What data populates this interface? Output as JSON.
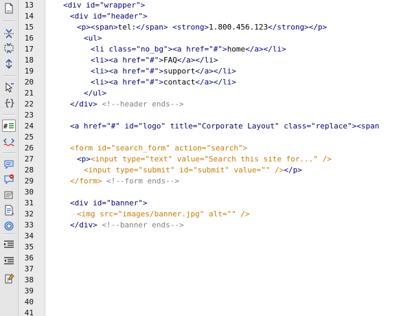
{
  "toolbar": {
    "tools": [
      "open-documents-icon",
      "collapse-full-tag-icon",
      "collapse-selection-icon",
      "expand-all-icon",
      "select-parent-tag-icon",
      "balance-braces-icon",
      "line-numbers-icon",
      "highlight-invalid-code-icon",
      "apply-comment-icon",
      "remove-comment-icon",
      "wrap-tag-icon",
      "recent-snippets-icon",
      "move-css-icon",
      "indent-code-icon",
      "outdent-code-icon",
      "format-source-code-icon"
    ]
  },
  "gutter": {
    "line_numbers": [
      "13",
      "14",
      "15",
      "16",
      "17",
      "18",
      "19",
      "20",
      "21",
      "22",
      "23",
      "24",
      "25",
      "26",
      "27",
      "28",
      "29",
      "30",
      "31",
      "32",
      "33",
      "34",
      "35",
      "36",
      "37",
      "38",
      "39",
      "40",
      "41"
    ]
  },
  "code": {
    "lines": [
      [
        {
          "t": "<div id=\"wrapper\">",
          "c": "tag"
        }
      ],
      [
        {
          "t": "<div id=\"header\">",
          "c": "tag"
        }
      ],
      [
        {
          "t": "<p><span>",
          "c": "tag"
        },
        {
          "t": "tel:",
          "c": "txt"
        },
        {
          "t": "</span> <strong>",
          "c": "tag"
        },
        {
          "t": "1.800.456.123",
          "c": "txt"
        },
        {
          "t": "</strong></p>",
          "c": "tag"
        }
      ],
      [
        {
          "t": "<ul>",
          "c": "tag"
        }
      ],
      [
        {
          "t": "<li class=\"no_bg\"><a href=\"#\">",
          "c": "tag"
        },
        {
          "t": "home",
          "c": "txt"
        },
        {
          "t": "</a></li>",
          "c": "tag"
        }
      ],
      [
        {
          "t": "<li><a href=\"#\">",
          "c": "tag"
        },
        {
          "t": "FAQ",
          "c": "txt"
        },
        {
          "t": "</a></li>",
          "c": "tag"
        }
      ],
      [
        {
          "t": "<li><a href=\"#\">",
          "c": "tag"
        },
        {
          "t": "support",
          "c": "txt"
        },
        {
          "t": "</a></li>",
          "c": "tag"
        }
      ],
      [
        {
          "t": "<li><a href=\"#\">",
          "c": "tag"
        },
        {
          "t": "contact",
          "c": "txt"
        },
        {
          "t": "</a></li>",
          "c": "tag"
        }
      ],
      [
        {
          "t": "</ul>",
          "c": "tag"
        }
      ],
      [
        {
          "t": "</div>",
          "c": "tag"
        },
        {
          "t": " <!--header ends-->",
          "c": "cmt"
        }
      ],
      [],
      [
        {
          "t": "<a href=\"#\" id=\"logo\" title=\"Corporate Layout\" class=\"replace\"><span",
          "c": "tag"
        }
      ],
      [],
      [
        {
          "t": "<form id=\"search_form\" action=\"search\">",
          "c": "orange"
        }
      ],
      [
        {
          "t": "<p>",
          "c": "tag"
        },
        {
          "t": "<input type=\"text\" value=\"Search this site for...\" />",
          "c": "orange"
        }
      ],
      [
        {
          "t": "<input type=\"submit\" id=\"submit\" value=\"\" />",
          "c": "orange"
        },
        {
          "t": "</p>",
          "c": "tag"
        }
      ],
      [
        {
          "t": "</form>",
          "c": "orange"
        },
        {
          "t": " <!--form ends-->",
          "c": "cmt"
        }
      ],
      [],
      [
        {
          "t": "<div id=\"banner\">",
          "c": "tag"
        }
      ],
      [
        {
          "t": "<img src=\"images/banner.jpg\" alt=\"\" />",
          "c": "orange"
        }
      ],
      [
        {
          "t": "</div>",
          "c": "tag"
        },
        {
          "t": " <!--banner ends-->",
          "c": "cmt"
        }
      ],
      [],
      [],
      [],
      [],
      [],
      [],
      [],
      []
    ]
  }
}
